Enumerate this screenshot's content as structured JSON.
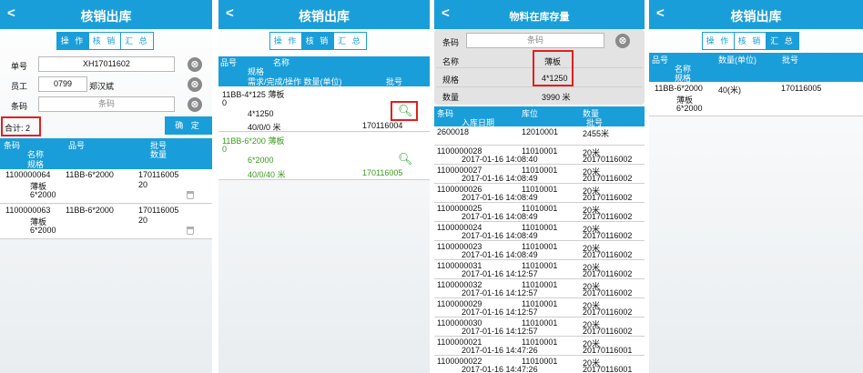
{
  "screen1": {
    "title": "核销出库",
    "back": "<",
    "tabs": [
      "操 作",
      "核 销",
      "汇 总"
    ],
    "fields": [
      {
        "label": "单号",
        "value": "XH17011602",
        "placeholder": ""
      },
      {
        "label": "员工",
        "value": "0799",
        "extra": "郑汉斌"
      },
      {
        "label": "条码",
        "value": "",
        "placeholder": "条码"
      }
    ],
    "clear_icon": "⊗",
    "total_label": "合计: 2",
    "confirm_label": "确 定",
    "table_headers": {
      "col1": "条码",
      "col1b": "名称",
      "col1c": "规格",
      "col2": "品号",
      "col3": "批号",
      "col3b": "数量"
    },
    "rows": [
      {
        "barcode": "1100000064",
        "item": "11BB-6*2000",
        "batch": "170116005",
        "name": "薄板",
        "qty": "20",
        "spec": "6*2000"
      },
      {
        "barcode": "1100000063",
        "item": "11BB-6*2000",
        "batch": "170116005",
        "name": "薄板",
        "qty": "20",
        "spec": "6*2000"
      }
    ]
  },
  "screen2": {
    "title": "核销出库",
    "back": "<",
    "tabs": [
      "操 作",
      "核 销",
      "汇 总"
    ],
    "headers": {
      "h1": "品号",
      "h2": "名称",
      "h3": "规格",
      "h4": "需求/完成/操作 数量(单位)",
      "h5": "批号"
    },
    "rows": [
      {
        "line1": "11BB-4*125  薄板",
        "line2": "0",
        "spec": "4*1250",
        "qty": "40/0/0 米",
        "batch": "170116004"
      },
      {
        "line1": "11BB-6*200  薄板",
        "line2": "0",
        "spec": "6*2000",
        "qty": "40/0/40 米",
        "batch": "170116005"
      }
    ]
  },
  "screen3": {
    "title": "物料在库存量",
    "back": "<",
    "barcode_label": "条码",
    "barcode_placeholder": "条码",
    "name_label": "名称",
    "name_value": "薄板",
    "spec_label": "规格",
    "spec_value": "4*1250",
    "qty_label": "数量",
    "qty_value": "3990 米",
    "headers": {
      "h1": "条码",
      "h2": "库位",
      "h3": "数量",
      "h4": "入库日期",
      "h5": "批号"
    },
    "rows": [
      {
        "barcode": "2600018",
        "loc": "12010001",
        "qty": "2455米",
        "date": "",
        "batch": ""
      },
      {
        "barcode": "1100000028",
        "loc": "11010001",
        "qty": "20米",
        "date": "2017-01-16 14:08:40",
        "batch": "20170116002"
      },
      {
        "barcode": "1100000027",
        "loc": "11010001",
        "qty": "20米",
        "date": "2017-01-16 14:08:49",
        "batch": "20170116002"
      },
      {
        "barcode": "1100000026",
        "loc": "11010001",
        "qty": "20米",
        "date": "2017-01-16 14:08:49",
        "batch": "20170116002"
      },
      {
        "barcode": "1100000025",
        "loc": "11010001",
        "qty": "20米",
        "date": "2017-01-16 14:08:49",
        "batch": "20170116002"
      },
      {
        "barcode": "1100000024",
        "loc": "11010001",
        "qty": "20米",
        "date": "2017-01-16 14:08:49",
        "batch": "20170116002"
      },
      {
        "barcode": "1100000023",
        "loc": "11010001",
        "qty": "20米",
        "date": "2017-01-16 14:08:49",
        "batch": "20170116002"
      },
      {
        "barcode": "1100000031",
        "loc": "11010001",
        "qty": "20米",
        "date": "2017-01-16 14:12:57",
        "batch": "20170116002"
      },
      {
        "barcode": "1100000032",
        "loc": "11010001",
        "qty": "20米",
        "date": "2017-01-16 14:12:57",
        "batch": "20170116002"
      },
      {
        "barcode": "1100000029",
        "loc": "11010001",
        "qty": "20米",
        "date": "2017-01-16 14:12:57",
        "batch": "20170116002"
      },
      {
        "barcode": "1100000030",
        "loc": "11010001",
        "qty": "20米",
        "date": "2017-01-16 14:12:57",
        "batch": "20170116002"
      },
      {
        "barcode": "1100000021",
        "loc": "11010001",
        "qty": "20米",
        "date": "2017-01-16 14:47:26",
        "batch": "20170116001"
      },
      {
        "barcode": "1100000022",
        "loc": "11010001",
        "qty": "20米",
        "date": "2017-01-16 14:47:26",
        "batch": "20170116001"
      }
    ]
  },
  "screen4": {
    "title": "核销出库",
    "back": "<",
    "tabs": [
      "操 作",
      "核 销",
      "汇 总"
    ],
    "headers": {
      "h1": "品号",
      "h2": "名称",
      "h3": "规格",
      "h4": "数量(单位)",
      "h5": "批号"
    },
    "row": {
      "item": "11BB-6*2000",
      "name": "薄板",
      "spec": "6*2000",
      "qty": "40(米)",
      "batch": "170116005"
    }
  },
  "colors": {
    "accent": "#1a9ed9",
    "green": "#3a9a1a",
    "highlight": "#e02020"
  }
}
